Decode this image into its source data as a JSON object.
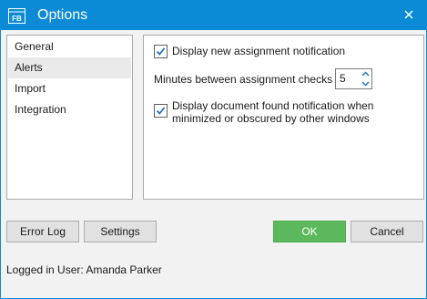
{
  "window": {
    "title": "Options",
    "app_icon": "fb-app-icon",
    "accent_color": "#0b8bd6"
  },
  "sidebar": {
    "items": [
      {
        "label": "General",
        "selected": false
      },
      {
        "label": "Alerts",
        "selected": true
      },
      {
        "label": "Import",
        "selected": false
      },
      {
        "label": "Integration",
        "selected": false
      }
    ]
  },
  "alerts": {
    "display_new_assignment": {
      "label": "Display new assignment notification",
      "checked": true
    },
    "minutes_between_checks": {
      "label": "Minutes between assignment checks",
      "value": "5"
    },
    "display_document_found": {
      "label_line1": "Display document found notification when",
      "label_line2": "minimized or obscured by other windows",
      "checked": true
    }
  },
  "buttons": {
    "error_log": "Error Log",
    "settings": "Settings",
    "ok": "OK",
    "cancel": "Cancel",
    "ok_color": "#5cb85c"
  },
  "status": {
    "logged_in": "Logged in User: Amanda Parker"
  }
}
